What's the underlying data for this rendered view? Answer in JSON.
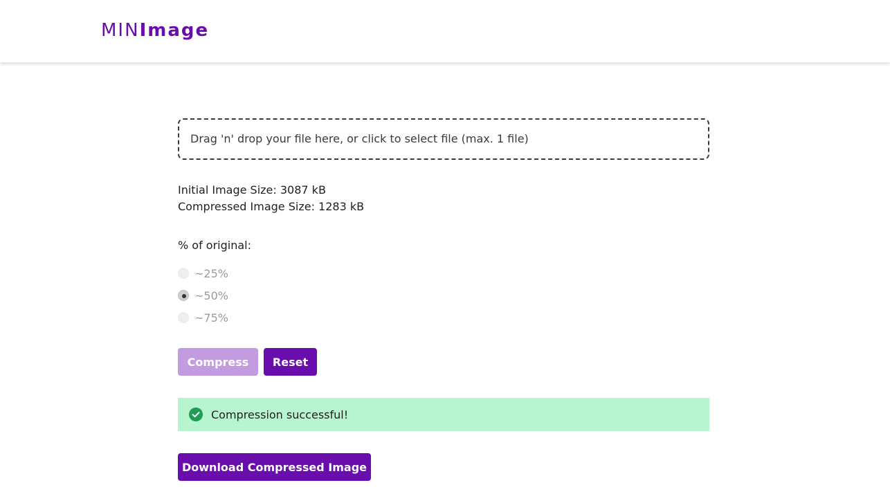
{
  "header": {
    "logo_thin": "MIN",
    "logo_bold": "Image"
  },
  "dropzone": {
    "text": "Drag 'n' drop your file here, or click to select file (max. 1 file)"
  },
  "sizes": {
    "initial": "Initial Image Size: 3087 kB",
    "compressed": "Compressed Image Size: 1283 kB"
  },
  "options": {
    "label": "% of original:",
    "items": [
      {
        "label": "~25%",
        "selected": false
      },
      {
        "label": "~50%",
        "selected": true
      },
      {
        "label": "~75%",
        "selected": false
      }
    ]
  },
  "buttons": {
    "compress": "Compress",
    "reset": "Reset",
    "download": "Download Compressed Image"
  },
  "alert": {
    "text": "Compression successful!",
    "icon": "check-circle-icon"
  },
  "colors": {
    "brand": "#6a0dad",
    "brand_disabled": "#c39be0",
    "success_bg": "#b7f4d0",
    "success_icon": "#1f9d55"
  }
}
